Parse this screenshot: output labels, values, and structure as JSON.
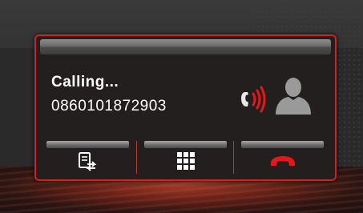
{
  "call": {
    "status": "Calling...",
    "number": "0860101872903"
  },
  "icons": {
    "ringing": "phone-ringing-icon",
    "contact": "person-silhouette-icon",
    "transfer": "call-transfer-icon",
    "keypad": "dialpad-grid-icon",
    "hangup": "hang-up-phone-icon"
  },
  "colors": {
    "accent_red": "#d32020",
    "panel_background": "#231f1f",
    "text": "#ffffff"
  }
}
